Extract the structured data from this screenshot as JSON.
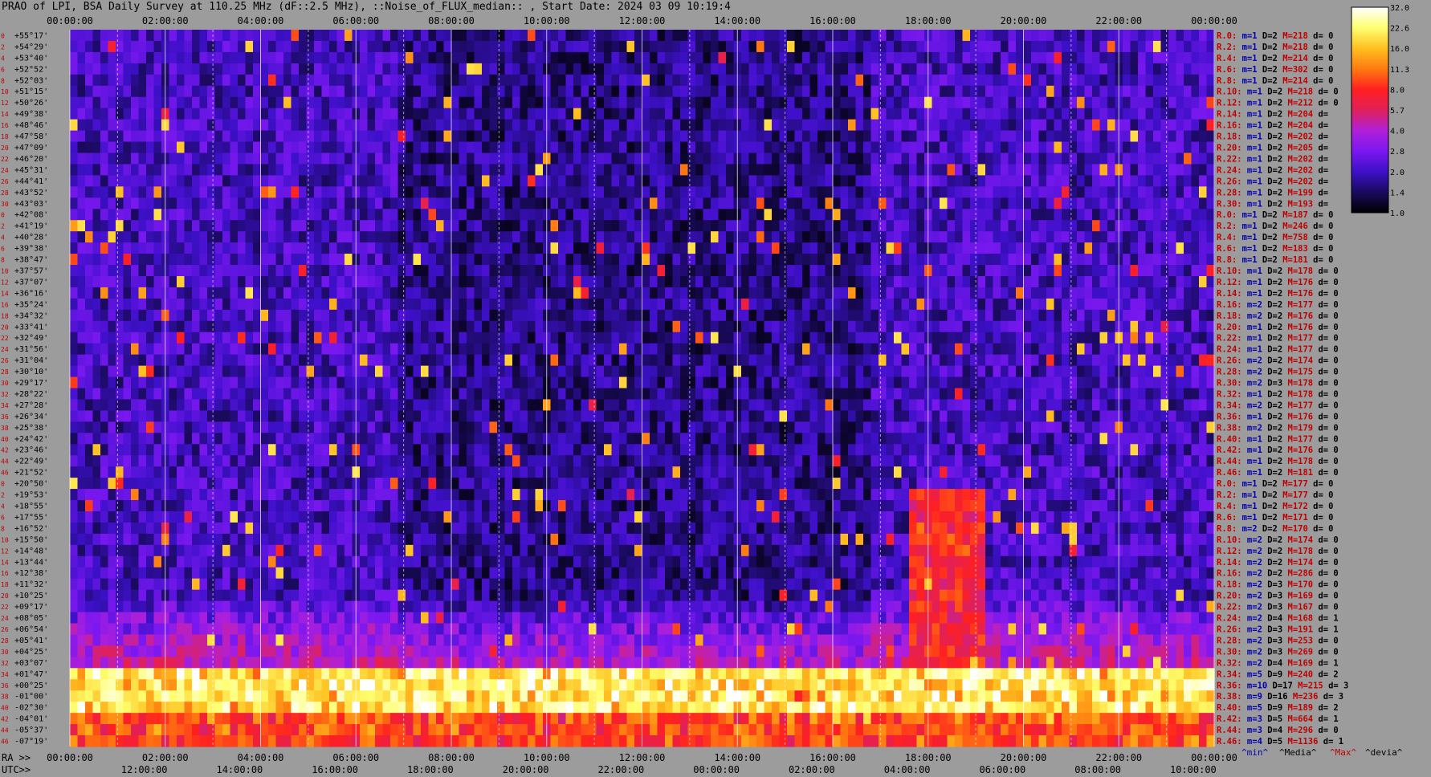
{
  "chart_data": {
    "type": "heatmap",
    "title": "PRAO of LPI, BSA Daily Survey at 110.25 MHz (dF::2.5 MHz), ::Noise_of_FLUX_median:: , Start Date: 2024 03 09 10:19:4",
    "top_ticks": [
      "00:00:00",
      "02:00:00",
      "04:00:00",
      "06:00:00",
      "08:00:00",
      "10:00:00",
      "12:00:00",
      "14:00:00",
      "16:00:00",
      "18:00:00",
      "20:00:00",
      "22:00:00",
      "00:00:00"
    ],
    "bottom_ra_prefix": "RA >>",
    "bottom_ra_ticks": [
      "00:00:00",
      "02:00:00",
      "04:00:00",
      "06:00:00",
      "08:00:00",
      "10:00:00",
      "12:00:00",
      "14:00:00",
      "16:00:00",
      "18:00:00",
      "20:00:00",
      "22:00:00",
      "00:00:00"
    ],
    "bottom_utc_prefix": "UTC>>",
    "bottom_utc_ticks": [
      "12:00:00",
      "14:00:00",
      "16:00:00",
      "18:00:00",
      "20:00:00",
      "22:00:00",
      "00:00:00",
      "02:00:00",
      "04:00:00",
      "06:00:00",
      "08:00:00",
      "10:00:00"
    ],
    "declinations": [
      "+55°17'",
      "+54°29'",
      "+53°40'",
      "+52°52'",
      "+52°03'",
      "+51°15'",
      "+50°26'",
      "+49°38'",
      "+48°46'",
      "+47°58'",
      "+47°09'",
      "+46°20'",
      "+45°31'",
      "+44°41'",
      "+43°52'",
      "+43°03'",
      "+42°08'",
      "+41°19'",
      "+40°28'",
      "+39°38'",
      "+38°47'",
      "+37°57'",
      "+37°07'",
      "+36°16'",
      "+35°24'",
      "+34°32'",
      "+33°41'",
      "+32°49'",
      "+31°56'",
      "+31°04'",
      "+30°10'",
      "+29°17'",
      "+28°22'",
      "+27°28'",
      "+26°34'",
      "+25°38'",
      "+24°42'",
      "+23°46'",
      "+22°49'",
      "+21°52'",
      "+20°50'",
      "+19°53'",
      "+18°55'",
      "+17°55'",
      "+16°52'",
      "+15°50'",
      "+14°48'",
      "+13°44'",
      "+12°38'",
      "+11°32'",
      "+10°25'",
      "+09°17'",
      "+08°05'",
      "+06°54'",
      "+05°41'",
      "+04°25'",
      "+03°07'",
      "+01°47'",
      "+00°25'",
      "-01°00'",
      "-02°30'",
      "-04°01'",
      "-05°37'",
      "-07°19'"
    ],
    "row_index": [
      "0",
      "2",
      "4",
      "6",
      "8",
      "10",
      "12",
      "14",
      "16",
      "18",
      "20",
      "22",
      "24",
      "26",
      "28",
      "30",
      "0",
      "2",
      "4",
      "6",
      "8",
      "10",
      "12",
      "14",
      "16",
      "18",
      "20",
      "22",
      "24",
      "26",
      "28",
      "30",
      "32",
      "34",
      "36",
      "38",
      "40",
      "42",
      "44",
      "46",
      "0",
      "2",
      "4",
      "6",
      "8",
      "10",
      "12",
      "14",
      "16",
      "18",
      "20",
      "22",
      "24",
      "26",
      "28",
      "30",
      "32",
      "34",
      "36",
      "38",
      "40",
      "42",
      "44",
      "46"
    ],
    "stats": [
      {
        "r": "R.0:",
        "m": "m=1",
        "d": "D=2",
        "M": "M=218",
        "dev": "d= 0"
      },
      {
        "r": "R.2:",
        "m": "m=1",
        "d": "D=2",
        "M": "M=218",
        "dev": "d= 0"
      },
      {
        "r": "R.4:",
        "m": "m=1",
        "d": "D=2",
        "M": "M=214",
        "dev": "d= 0"
      },
      {
        "r": "R.6:",
        "m": "m=1",
        "d": "D=2",
        "M": "M=302",
        "dev": "d= 0"
      },
      {
        "r": "R.8:",
        "m": "m=1",
        "d": "D=2",
        "M": "M=214",
        "dev": "d= 0"
      },
      {
        "r": "R.10:",
        "m": "m=1",
        "d": "D=2",
        "M": "M=218",
        "dev": "d= 0"
      },
      {
        "r": "R.12:",
        "m": "m=1",
        "d": "D=2",
        "M": "M=212",
        "dev": "d= 0"
      },
      {
        "r": "R.14:",
        "m": "m=1",
        "d": "D=2",
        "M": "M=204",
        "dev": "d="
      },
      {
        "r": "R.16:",
        "m": "m=1",
        "d": "D=2",
        "M": "M=204",
        "dev": "d="
      },
      {
        "r": "R.18:",
        "m": "m=1",
        "d": "D=2",
        "M": "M=202",
        "dev": "d="
      },
      {
        "r": "R.20:",
        "m": "m=1",
        "d": "D=2",
        "M": "M=205",
        "dev": "d="
      },
      {
        "r": "R.22:",
        "m": "m=1",
        "d": "D=2",
        "M": "M=202",
        "dev": "d="
      },
      {
        "r": "R.24:",
        "m": "m=1",
        "d": "D=2",
        "M": "M=202",
        "dev": "d="
      },
      {
        "r": "R.26:",
        "m": "m=1",
        "d": "D=2",
        "M": "M=202",
        "dev": "d="
      },
      {
        "r": "R.28:",
        "m": "m=1",
        "d": "D=2",
        "M": "M=199",
        "dev": "d="
      },
      {
        "r": "R.30:",
        "m": "m=1",
        "d": "D=2",
        "M": "M=193",
        "dev": "d="
      },
      {
        "r": "R.0:",
        "m": "m=1",
        "d": "D=2",
        "M": "M=187",
        "dev": "d= 0"
      },
      {
        "r": "R.2:",
        "m": "m=1",
        "d": "D=2",
        "M": "M=246",
        "dev": "d= 0"
      },
      {
        "r": "R.4:",
        "m": "m=1",
        "d": "D=2",
        "M": "M=758",
        "dev": "d= 0"
      },
      {
        "r": "R.6:",
        "m": "m=1",
        "d": "D=2",
        "M": "M=183",
        "dev": "d= 0"
      },
      {
        "r": "R.8:",
        "m": "m=1",
        "d": "D=2",
        "M": "M=181",
        "dev": "d= 0"
      },
      {
        "r": "R.10:",
        "m": "m=1",
        "d": "D=2",
        "M": "M=178",
        "dev": "d= 0"
      },
      {
        "r": "R.12:",
        "m": "m=1",
        "d": "D=2",
        "M": "M=176",
        "dev": "d= 0"
      },
      {
        "r": "R.14:",
        "m": "m=1",
        "d": "D=2",
        "M": "M=176",
        "dev": "d= 0"
      },
      {
        "r": "R.16:",
        "m": "m=2",
        "d": "D=2",
        "M": "M=177",
        "dev": "d= 0"
      },
      {
        "r": "R.18:",
        "m": "m=2",
        "d": "D=2",
        "M": "M=176",
        "dev": "d= 0"
      },
      {
        "r": "R.20:",
        "m": "m=1",
        "d": "D=2",
        "M": "M=176",
        "dev": "d= 0"
      },
      {
        "r": "R.22:",
        "m": "m=1",
        "d": "D=2",
        "M": "M=177",
        "dev": "d= 0"
      },
      {
        "r": "R.24:",
        "m": "m=1",
        "d": "D=2",
        "M": "M=177",
        "dev": "d= 0"
      },
      {
        "r": "R.26:",
        "m": "m=2",
        "d": "D=2",
        "M": "M=174",
        "dev": "d= 0"
      },
      {
        "r": "R.28:",
        "m": "m=2",
        "d": "D=2",
        "M": "M=175",
        "dev": "d= 0"
      },
      {
        "r": "R.30:",
        "m": "m=2",
        "d": "D=3",
        "M": "M=178",
        "dev": "d= 0"
      },
      {
        "r": "R.32:",
        "m": "m=1",
        "d": "D=2",
        "M": "M=178",
        "dev": "d= 0"
      },
      {
        "r": "R.34:",
        "m": "m=2",
        "d": "D=2",
        "M": "M=177",
        "dev": "d= 0"
      },
      {
        "r": "R.36:",
        "m": "m=1",
        "d": "D=2",
        "M": "M=176",
        "dev": "d= 0"
      },
      {
        "r": "R.38:",
        "m": "m=2",
        "d": "D=2",
        "M": "M=179",
        "dev": "d= 0"
      },
      {
        "r": "R.40:",
        "m": "m=1",
        "d": "D=2",
        "M": "M=177",
        "dev": "d= 0"
      },
      {
        "r": "R.42:",
        "m": "m=1",
        "d": "D=2",
        "M": "M=176",
        "dev": "d= 0"
      },
      {
        "r": "R.44:",
        "m": "m=1",
        "d": "D=2",
        "M": "M=178",
        "dev": "d= 0"
      },
      {
        "r": "R.46:",
        "m": "m=1",
        "d": "D=2",
        "M": "M=181",
        "dev": "d= 0"
      },
      {
        "r": "R.0:",
        "m": "m=1",
        "d": "D=2",
        "M": "M=177",
        "dev": "d= 0"
      },
      {
        "r": "R.2:",
        "m": "m=1",
        "d": "D=2",
        "M": "M=177",
        "dev": "d= 0"
      },
      {
        "r": "R.4:",
        "m": "m=1",
        "d": "D=2",
        "M": "M=172",
        "dev": "d= 0"
      },
      {
        "r": "R.6:",
        "m": "m=1",
        "d": "D=2",
        "M": "M=171",
        "dev": "d= 0"
      },
      {
        "r": "R.8:",
        "m": "m=2",
        "d": "D=2",
        "M": "M=170",
        "dev": "d= 0"
      },
      {
        "r": "R.10:",
        "m": "m=2",
        "d": "D=2",
        "M": "M=174",
        "dev": "d= 0"
      },
      {
        "r": "R.12:",
        "m": "m=2",
        "d": "D=2",
        "M": "M=178",
        "dev": "d= 0"
      },
      {
        "r": "R.14:",
        "m": "m=2",
        "d": "D=2",
        "M": "M=174",
        "dev": "d= 0"
      },
      {
        "r": "R.16:",
        "m": "m=2",
        "d": "D=2",
        "M": "M=286",
        "dev": "d= 0"
      },
      {
        "r": "R.18:",
        "m": "m=2",
        "d": "D=3",
        "M": "M=170",
        "dev": "d= 0"
      },
      {
        "r": "R.20:",
        "m": "m=2",
        "d": "D=3",
        "M": "M=169",
        "dev": "d= 0"
      },
      {
        "r": "R.22:",
        "m": "m=2",
        "d": "D=3",
        "M": "M=167",
        "dev": "d= 0"
      },
      {
        "r": "R.24:",
        "m": "m=2",
        "d": "D=4",
        "M": "M=168",
        "dev": "d= 1"
      },
      {
        "r": "R.26:",
        "m": "m=2",
        "d": "D=3",
        "M": "M=191",
        "dev": "d= 1"
      },
      {
        "r": "R.28:",
        "m": "m=2",
        "d": "D=3",
        "M": "M=253",
        "dev": "d= 0"
      },
      {
        "r": "R.30:",
        "m": "m=2",
        "d": "D=3",
        "M": "M=269",
        "dev": "d= 0"
      },
      {
        "r": "R.32:",
        "m": "m=2",
        "d": "D=4",
        "M": "M=169",
        "dev": "d= 1"
      },
      {
        "r": "R.34:",
        "m": "m=5",
        "d": "D=9",
        "M": "M=240",
        "dev": "d= 2"
      },
      {
        "r": "R.36:",
        "m": "m=10",
        "d": "D=17",
        "M": "M=215",
        "dev": "d= 3"
      },
      {
        "r": "R.38:",
        "m": "m=9",
        "d": "D=16",
        "M": "M=236",
        "dev": "d= 3"
      },
      {
        "r": "R.40:",
        "m": "m=5",
        "d": "D=9",
        "M": "M=189",
        "dev": "d= 2"
      },
      {
        "r": "R.42:",
        "m": "m=3",
        "d": "D=5",
        "M": "M=664",
        "dev": "d= 1"
      },
      {
        "r": "R.44:",
        "m": "m=3",
        "d": "D=4",
        "M": "M=296",
        "dev": "d= 0"
      },
      {
        "r": "R.46:",
        "m": "m=4",
        "d": "D=5",
        "M": "M=1136",
        "dev": "d= 1"
      }
    ],
    "legend_footer": {
      "min": "^min^",
      "median": "^Media^",
      "max": "^Max^",
      "dev": "^devia^"
    },
    "colorbar_ticks": [
      "32.0",
      "22.6",
      "16.0",
      "11.3",
      "8.0",
      "5.7",
      "4.0",
      "2.8",
      "2.0",
      "1.4",
      "1.0"
    ],
    "colorbar_range": [
      1.0,
      32.0
    ],
    "colorbar_scale": "log",
    "colorscale": [
      "#000000",
      "#1a0a5e",
      "#3d10c8",
      "#7a18f0",
      "#b020d8",
      "#e0205a",
      "#ff2020",
      "#ff7a10",
      "#ffc020",
      "#ffff70",
      "#ffffff"
    ],
    "colors": {
      "background": "#9c9c9c",
      "label_red": "#c00000",
      "label_blue": "#0000b0",
      "label_black": "#000000"
    }
  }
}
